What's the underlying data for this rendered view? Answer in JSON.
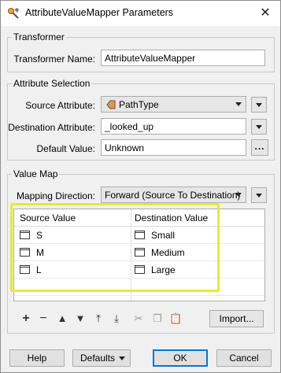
{
  "window": {
    "title": "AttributeValueMapper Parameters",
    "close_glyph": "✕"
  },
  "transformer": {
    "group_label": "Transformer",
    "name_label": "Transformer Name:",
    "name_value": "AttributeValueMapper"
  },
  "attribute_selection": {
    "group_label": "Attribute Selection",
    "source_label": "Source Attribute:",
    "source_value": "PathType",
    "destination_label": "Destination Attribute:",
    "destination_value": "_looked_up",
    "default_label": "Default Value:",
    "default_value": "Unknown",
    "dots_label": "..."
  },
  "value_map": {
    "group_label": "Value Map",
    "direction_label": "Mapping Direction:",
    "direction_value": "Forward (Source To Destination)",
    "columns": [
      "Source Value",
      "Destination Value"
    ],
    "rows": [
      {
        "source": "S",
        "destination": "Small"
      },
      {
        "source": "M",
        "destination": "Medium"
      },
      {
        "source": "L",
        "destination": "Large"
      }
    ],
    "import_label": "Import..."
  },
  "footer": {
    "help_label": "Help",
    "defaults_label": "Defaults",
    "ok_label": "OK",
    "cancel_label": "Cancel"
  },
  "colors": {
    "highlight": "#dfee31",
    "ok_border": "#0078d7"
  }
}
